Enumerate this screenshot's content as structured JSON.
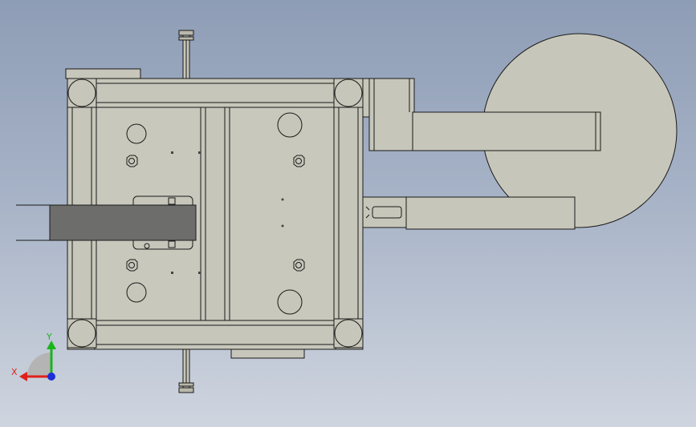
{
  "viewport": {
    "background_top": "#8e9db6",
    "background_bottom": "#cfd5df",
    "part_fill": "#c7c6ba",
    "part_fill_dark": "#b9b8ab",
    "belt_fill": "#6d6d6b",
    "edge_color": "#1a1a1a"
  },
  "triad": {
    "x_label": "X",
    "y_label": "Y",
    "x_color": "#e0201c",
    "y_color": "#19b51b",
    "z_color": "#1d2fd6"
  }
}
